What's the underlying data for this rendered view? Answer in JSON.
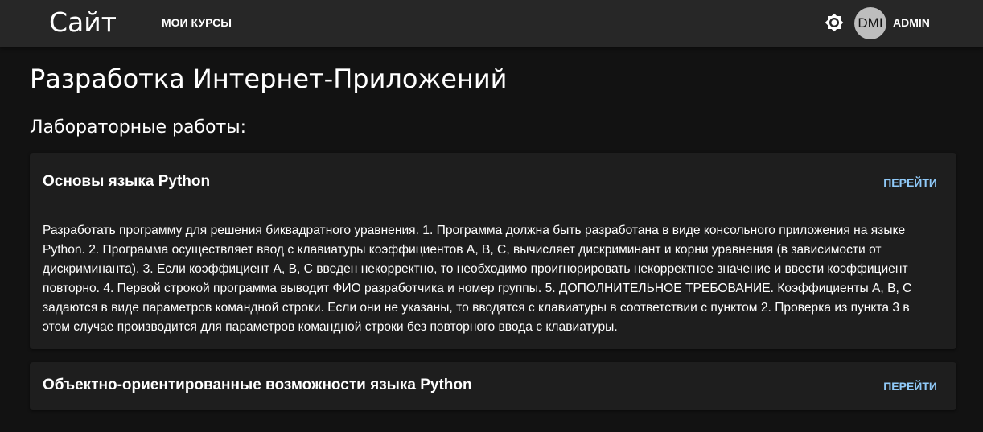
{
  "header": {
    "site_title": "Сайт",
    "nav_courses": "МОИ КУРСЫ",
    "theme_icon": "brightness-icon",
    "avatar_initials": "DMI",
    "user_name": "ADMIN"
  },
  "main": {
    "course_title": "Разработка Интернет-Приложений",
    "labs_heading": "Лабораторные работы:",
    "labs": [
      {
        "title": "Основы языка Python",
        "link_label": "ПЕРЕЙТИ",
        "description": "Разработать программу для решения биквадратного уравнения. 1. Программа должна быть разработана в виде консольного приложения на языке Python. 2. Программа осуществляет ввод с клавиатуры коэффициентов A, B, C, вычисляет дискриминант и корни уравнения (в зависимости от дискриминанта). 3. Если коэффициент A, B, C введен некорректно, то необходимо проигнорировать некорректное значение и ввести коэффициент повторно. 4. Первой строкой программа выводит ФИО разработчика и номер группы. 5. ДОПОЛНИТЕЛЬНОЕ ТРЕБОВАНИЕ. Коэффициенты A, B, C задаются в виде параметров командной строки. Если они не указаны, то вводятся с клавиатуры в соответствии с пунктом 2. Проверка из пункта 3 в этом случае производится для параметров командной строки без повторного ввода с клавиатуры."
      },
      {
        "title": "Объектно-ориентированные возможности языка Python",
        "link_label": "ПЕРЕЙТИ"
      }
    ]
  },
  "colors": {
    "background": "#121212",
    "appbar": "#272727",
    "card": "#1e1e1e",
    "link": "#90caf9",
    "avatar": "#bdbdbd"
  }
}
